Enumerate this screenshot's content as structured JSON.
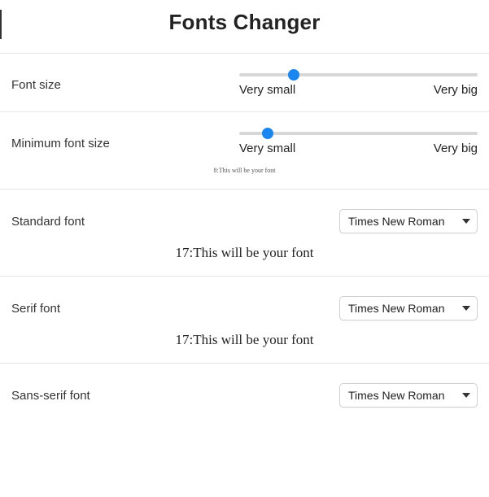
{
  "title": "Fonts Changer",
  "sliders": {
    "fontSize": {
      "label": "Font size",
      "min_label": "Very small",
      "max_label": "Very big",
      "thumb_percent": 23
    },
    "minFontSize": {
      "label": "Minimum font size",
      "min_label": "Very small",
      "max_label": "Very big",
      "thumb_percent": 12,
      "preview": "8:This will be your font"
    }
  },
  "fonts": {
    "standard": {
      "label": "Standard font",
      "value": "Times New Roman",
      "preview": "17:This will be your font"
    },
    "serif": {
      "label": "Serif font",
      "value": "Times New Roman",
      "preview": "17:This will be your font"
    },
    "sansSerif": {
      "label": "Sans-serif font",
      "value": "Times New Roman"
    }
  }
}
